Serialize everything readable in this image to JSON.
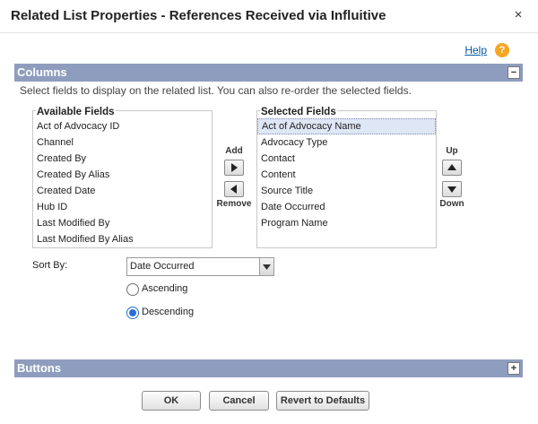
{
  "dialog": {
    "title": "Related List Properties - References Received via Influitive",
    "close_glyph": "×"
  },
  "help": {
    "label": "Help",
    "icon_glyph": "?"
  },
  "columns_section": {
    "label": "Columns",
    "toggle_glyph": "−",
    "instructions": "Select fields to display on the related list. You can also re-order the selected fields."
  },
  "available": {
    "label": "Available Fields",
    "items": [
      "Act of Advocacy ID",
      "Channel",
      "Created By",
      "Created By Alias",
      "Created Date",
      "Hub ID",
      "Last Modified By",
      "Last Modified By Alias"
    ]
  },
  "selected": {
    "label": "Selected Fields",
    "items": [
      "Act of Advocacy Name",
      "Advocacy Type",
      "Contact",
      "Content",
      "Source Title",
      "Date Occurred",
      "Program Name"
    ]
  },
  "move": {
    "add_label": "Add",
    "remove_label": "Remove",
    "up_label": "Up",
    "down_label": "Down"
  },
  "sort": {
    "label": "Sort By:",
    "value": "Date Occurred",
    "ascending_label": "Ascending",
    "descending_label": "Descending",
    "order": "descending"
  },
  "buttons_section": {
    "label": "Buttons",
    "toggle_glyph": "+"
  },
  "footer": {
    "ok_label": "OK",
    "cancel_label": "Cancel",
    "revert_label": "Revert to Defaults"
  }
}
